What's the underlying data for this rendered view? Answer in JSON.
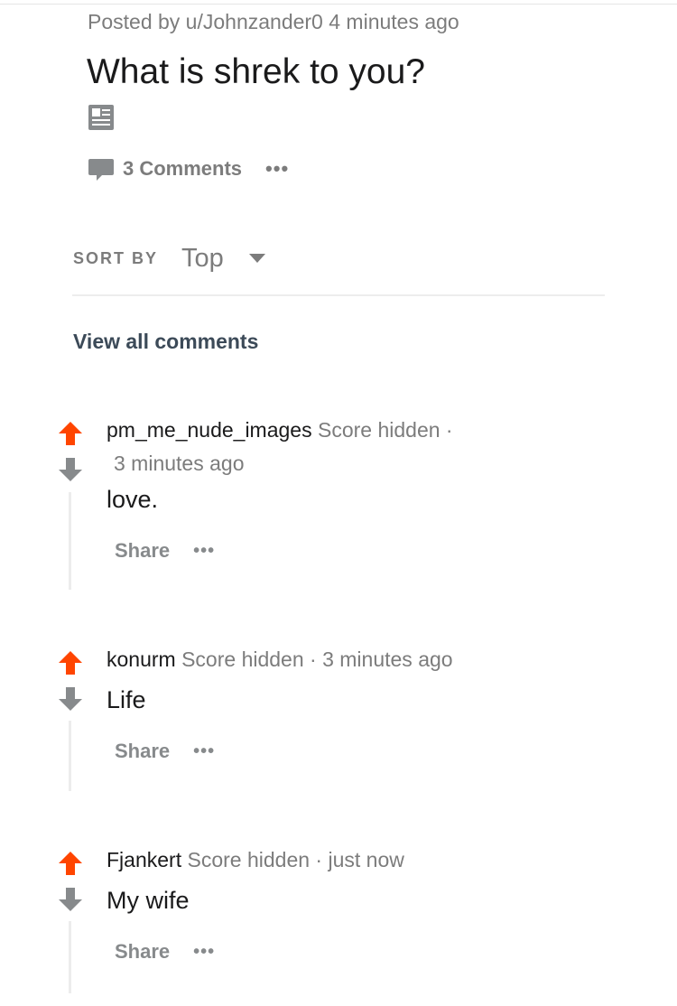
{
  "post": {
    "meta": "Posted by u/Johnzander0 4 minutes ago",
    "title": "What is shrek to you?",
    "post_type_icon": "text-post-icon",
    "comments_label": "3 Comments",
    "more_label": "•••"
  },
  "sort": {
    "label": "SORT BY",
    "value": "Top"
  },
  "view_all": "View all comments",
  "comments": [
    {
      "author": "pm_me_nude_images",
      "score": "Score hidden",
      "separator": "·",
      "time": "3 minutes ago",
      "body": "love.",
      "share": "Share",
      "more": "•••"
    },
    {
      "author": "konurm",
      "score": "Score hidden",
      "separator": "·",
      "time": "3 minutes ago",
      "body": "Life",
      "share": "Share",
      "more": "•••"
    },
    {
      "author": "Fjankert",
      "score": "Score hidden",
      "separator": "·",
      "time": "just now",
      "body": "My wife",
      "share": "Share",
      "more": "•••"
    }
  ],
  "colors": {
    "upvote": "#ff4500",
    "downvote_inactive": "#878a8c",
    "muted_text": "#7c7c7c",
    "link": "#3c4a58"
  }
}
